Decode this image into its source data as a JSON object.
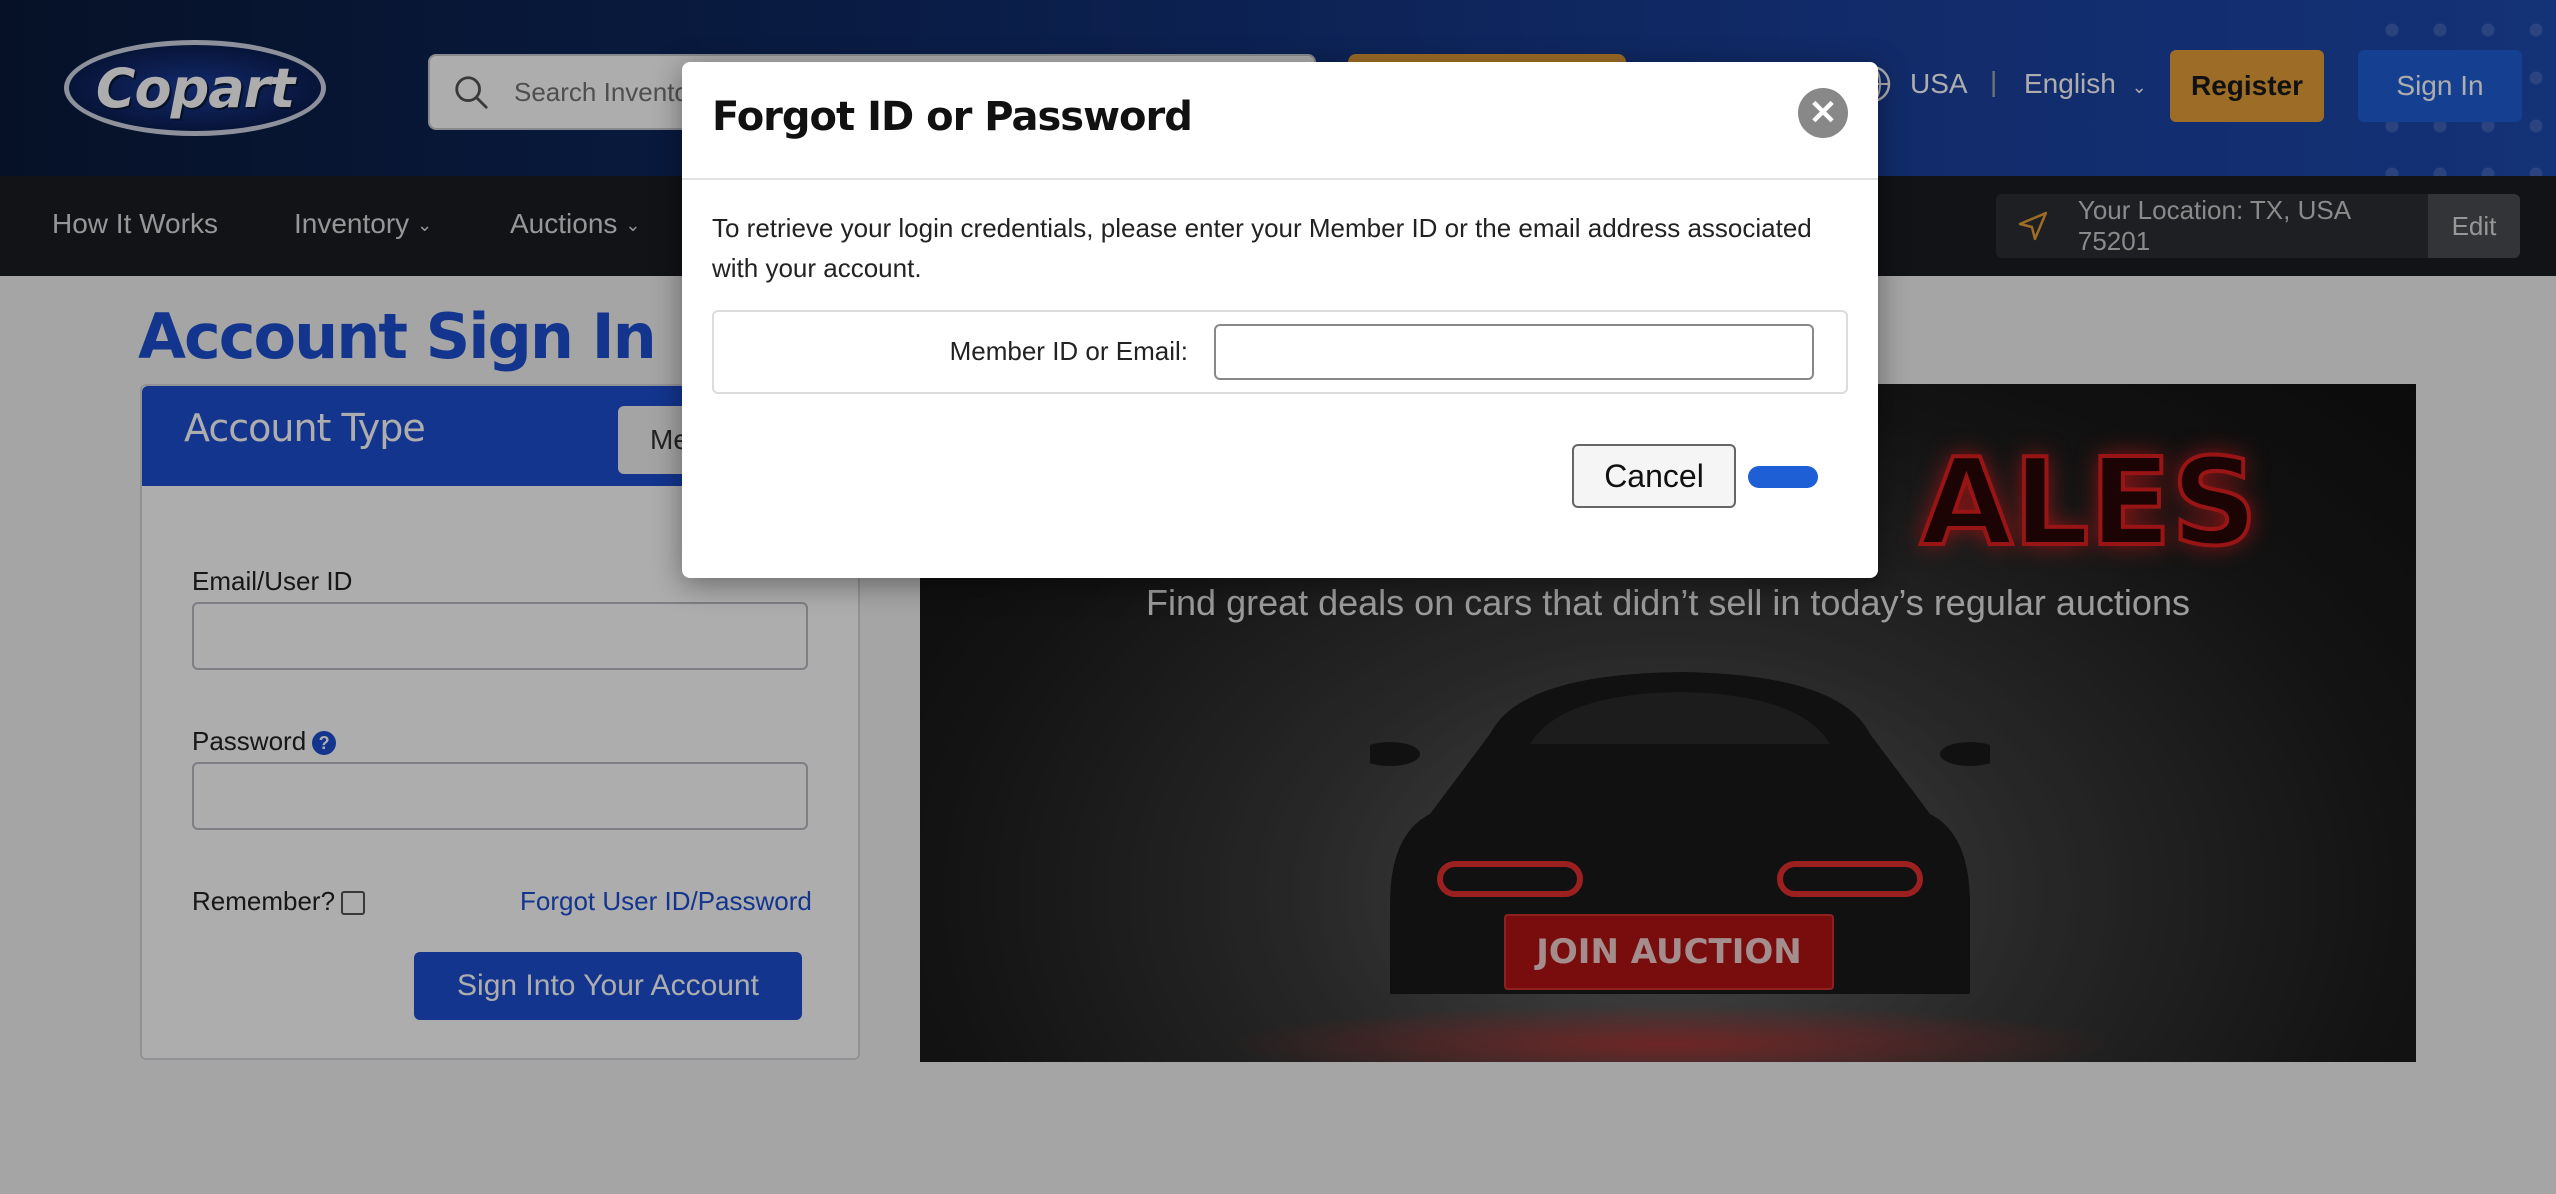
{
  "header": {
    "logo_text": "Copart",
    "search_placeholder": "Search Inventory",
    "country": "USA",
    "separator": "|",
    "language": "English",
    "register_label": "Register",
    "signin_label": "Sign In"
  },
  "nav": {
    "items": [
      {
        "label": "How It Works"
      },
      {
        "label": "Inventory"
      },
      {
        "label": "Auctions"
      }
    ],
    "location_label": "Your Location: TX, USA 75201",
    "edit_label": "Edit"
  },
  "main": {
    "title": "Account Sign In",
    "card": {
      "header_label": "Account Type",
      "tab_label": "Me",
      "email_label": "Email/User ID",
      "password_label": "Password",
      "remember_label": "Remember?",
      "forgot_link": "Forgot User ID/Password",
      "submit_label": "Sign Into Your Account"
    },
    "banner": {
      "headline": "ALES",
      "tagline": "Find great deals on cars that didn’t sell in today’s regular auctions",
      "cta": "JOIN AUCTION"
    }
  },
  "modal": {
    "title": "Forgot ID or Password",
    "description": "To retrieve your login credentials, please enter your Member ID or the email address associated with your account.",
    "field_label": "Member ID or Email:",
    "field_value": "",
    "cancel_label": "Cancel"
  },
  "colors": {
    "brand_blue": "#1d4fd1",
    "accent_orange": "#e8a03a",
    "nav_bg": "#1a1d22"
  }
}
